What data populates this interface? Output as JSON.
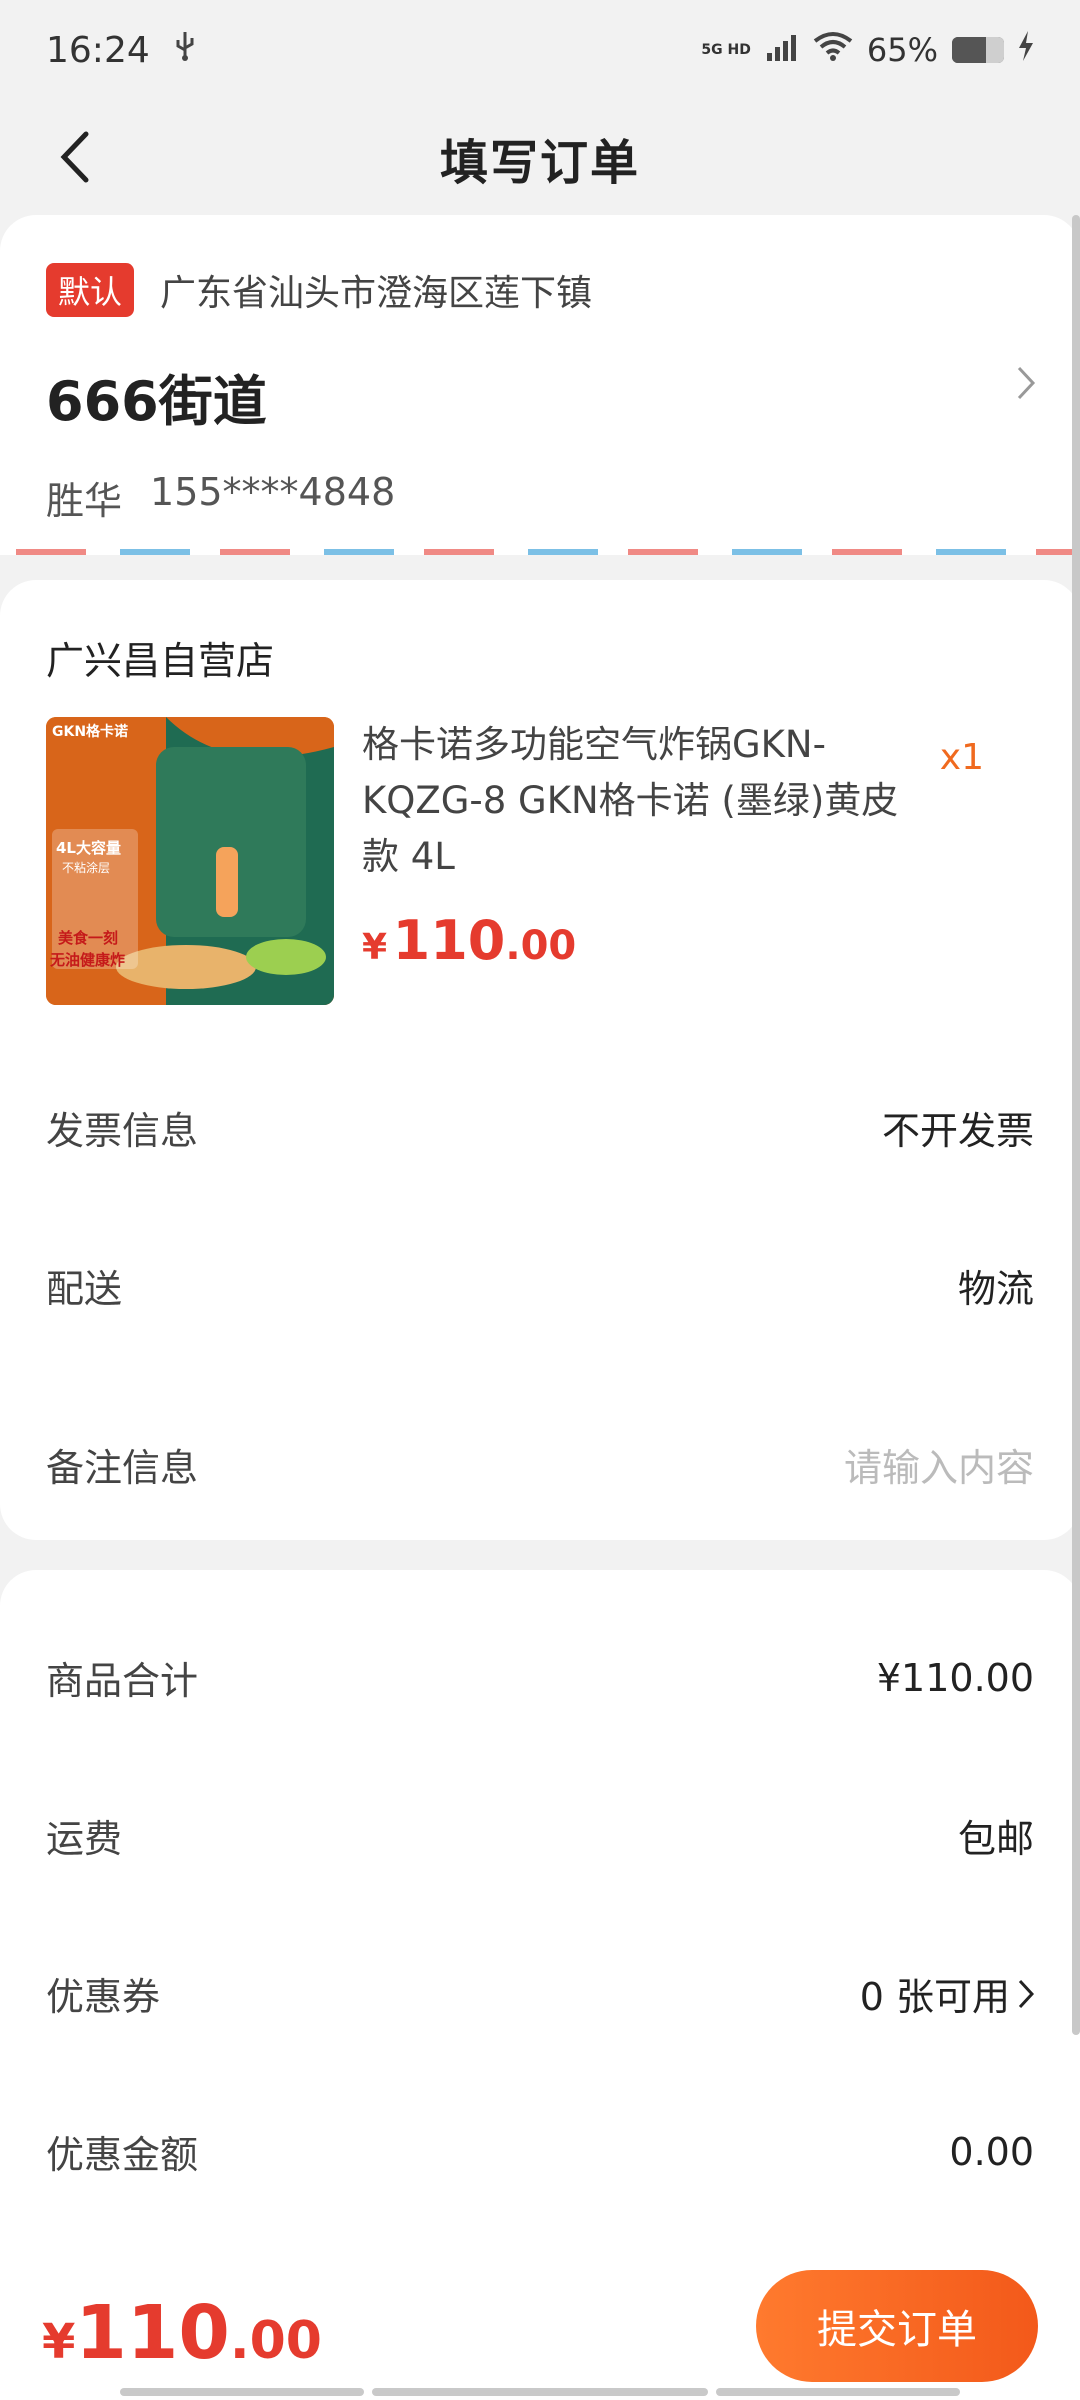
{
  "status_bar": {
    "time": "16:24",
    "network": "5G HD",
    "battery_percent": "65%",
    "battery_level": 0.65,
    "icons": [
      "usb-icon",
      "signal-icon",
      "wifi-icon",
      "battery-icon",
      "charging-icon"
    ]
  },
  "nav": {
    "title": "填写订单",
    "back_icon": "back-arrow-icon"
  },
  "address": {
    "tag": "默认",
    "region": "广东省汕头市澄海区莲下镇",
    "street": "666街道",
    "name": "胜华",
    "phone": "155****4848"
  },
  "order": {
    "shop_name": "广兴昌自营店",
    "product": {
      "title": "格卡诺多功能空气炸锅GKN-KQZG-8 GKN格卡诺 (墨绿)黄皮款 4L",
      "qty": "x1",
      "price_symbol": "¥",
      "price_int": "110",
      "price_dec": ".00",
      "image_badge": "GKN格卡诺",
      "image_text1": "4L大容量",
      "image_text2": "不粘涂层",
      "image_text3": "美食一刻",
      "image_text4": "无油健康炸"
    },
    "invoice_label": "发票信息",
    "invoice_value": "不开发票",
    "delivery_label": "配送",
    "delivery_value": "物流",
    "note_label": "备注信息",
    "note_placeholder": "请输入内容"
  },
  "summary": {
    "subtotal_label": "商品合计",
    "subtotal_value": "¥110.00",
    "shipping_label": "运费",
    "shipping_value": "包邮",
    "coupon_label": "优惠券",
    "coupon_value": "0 张可用",
    "discount_label": "优惠金额",
    "discount_value": "0.00"
  },
  "bottom_bar": {
    "total_symbol": "¥",
    "total_int": "110",
    "total_dec": ".00",
    "submit_label": "提交订单"
  },
  "colors": {
    "accent_red": "#e53b2e",
    "accent_orange": "#f3591a"
  }
}
